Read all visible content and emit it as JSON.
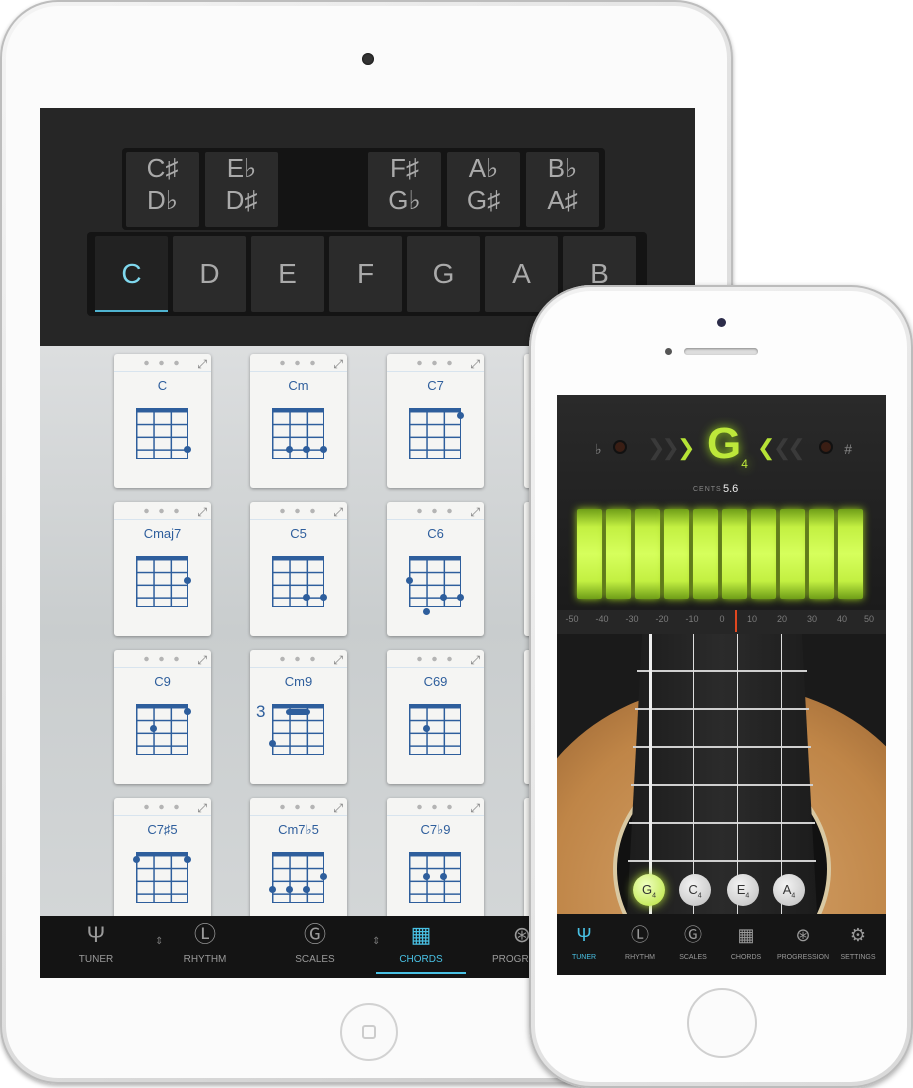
{
  "ipad": {
    "accidentals": [
      {
        "top": "C♯",
        "bottom": "D♭"
      },
      {
        "top": "E♭",
        "bottom": "D♯"
      },
      {
        "top": "F♯",
        "bottom": "G♭"
      },
      {
        "top": "A♭",
        "bottom": "G♯"
      },
      {
        "top": "B♭",
        "bottom": "A♯"
      }
    ],
    "naturals": [
      "C",
      "D",
      "E",
      "F",
      "G",
      "A",
      "B"
    ],
    "selected_root": "C",
    "chords": [
      "C",
      "Cm",
      "C7",
      "Cmaj7",
      "C5",
      "C6",
      "C9",
      "Cm9",
      "C69",
      "C7♯5",
      "Cm7♭5",
      "C7♭9"
    ],
    "cm9_fret": "3",
    "tabs": [
      {
        "label": "TUNER",
        "icon": "tuning-fork-icon"
      },
      {
        "label": "RHYTHM",
        "icon": "metronome-icon"
      },
      {
        "label": "SCALES",
        "icon": "scales-g-icon"
      },
      {
        "label": "CHORDS",
        "icon": "chord-grid-icon"
      },
      {
        "label": "PROGRESS",
        "icon": "progression-icon"
      }
    ],
    "active_tab": "CHORDS"
  },
  "iphone": {
    "flat_symbol": "♭",
    "sharp_symbol": "#",
    "note": "G",
    "octave": "4",
    "cents_label": "CENTS",
    "cents_value": "5.6",
    "scale_ticks": [
      "-50",
      "-40",
      "-30",
      "-20",
      "-10",
      "0",
      "10",
      "20",
      "30",
      "40",
      "50"
    ],
    "strings": [
      {
        "note": "G",
        "octave": "4",
        "active": true
      },
      {
        "note": "C",
        "octave": "4",
        "active": false
      },
      {
        "note": "E",
        "octave": "4",
        "active": false
      },
      {
        "note": "A",
        "octave": "4",
        "active": false
      }
    ],
    "tabs": [
      {
        "label": "TUNER",
        "icon": "tuning-fork-icon"
      },
      {
        "label": "RHYTHM",
        "icon": "metronome-icon"
      },
      {
        "label": "SCALES",
        "icon": "scales-g-icon"
      },
      {
        "label": "CHORDS",
        "icon": "chord-grid-icon"
      },
      {
        "label": "PROGRESSION",
        "icon": "progression-icon"
      },
      {
        "label": "SETTINGS",
        "icon": "gear-icon"
      }
    ],
    "active_tab": "TUNER",
    "accent_color": "#bde83a"
  }
}
